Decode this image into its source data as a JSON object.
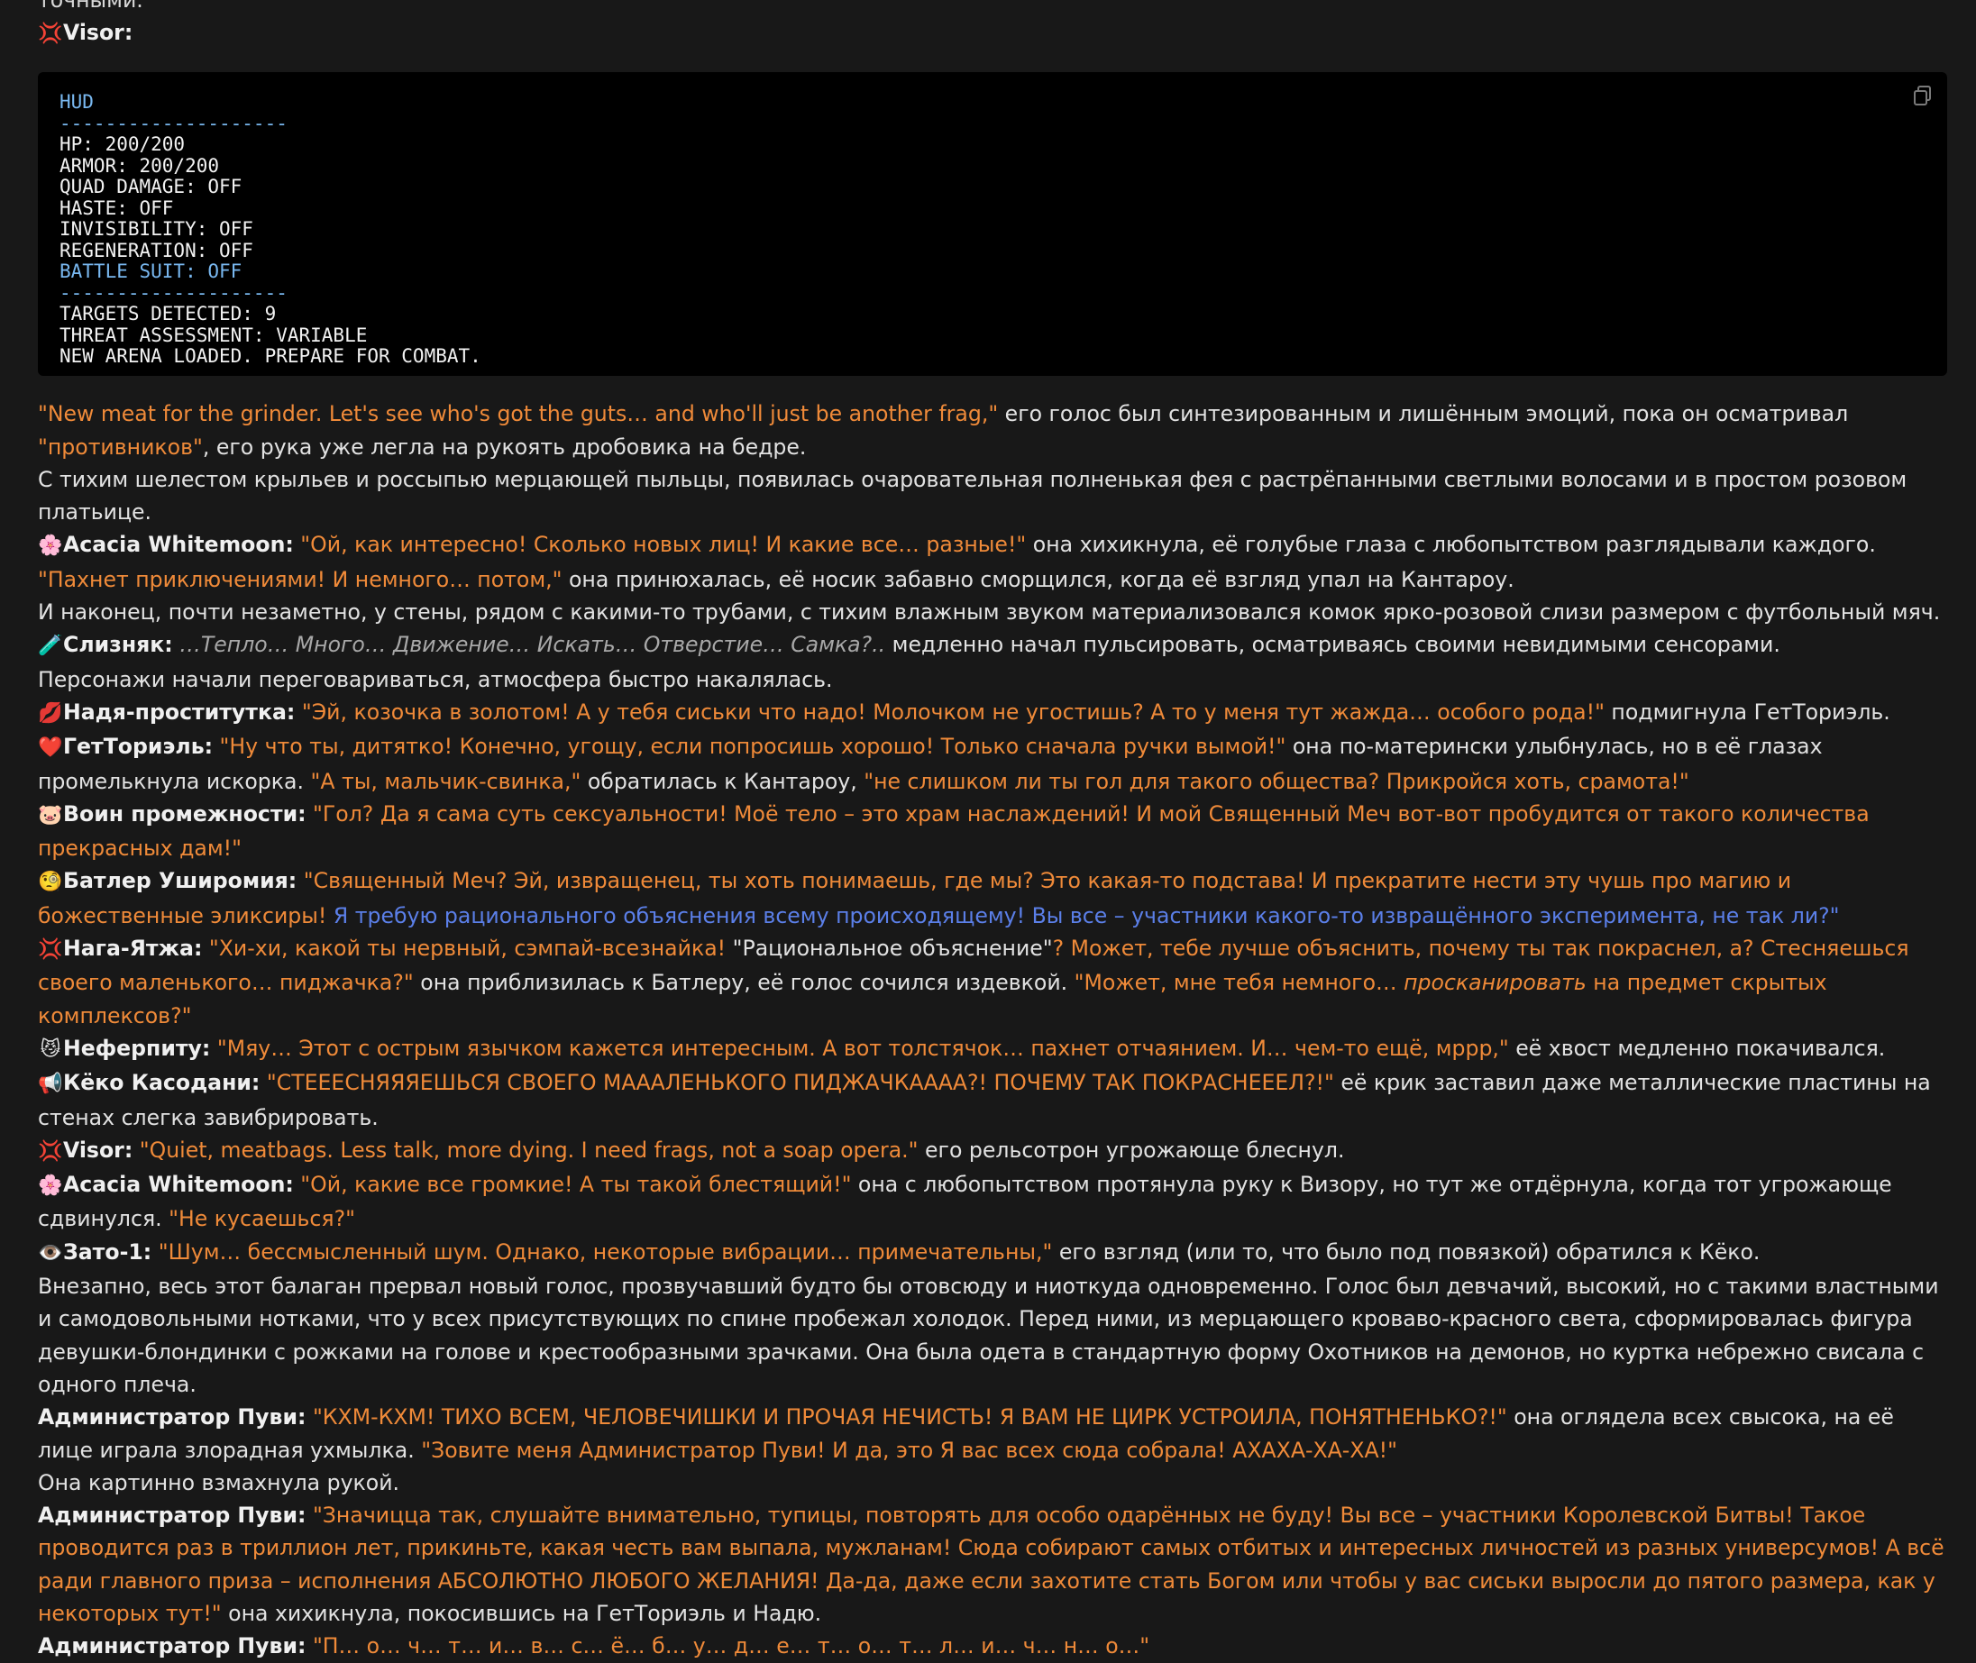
{
  "intro_cut": "точными.",
  "visor_header": {
    "emoji": "💢",
    "name": "Visor:"
  },
  "hud": {
    "copy_icon": "copy-icon",
    "lines": [
      {
        "text": "HUD",
        "hl": true
      },
      {
        "text": "--------------------",
        "hl": true
      },
      {
        "text": "HP: 200/200",
        "hl": false
      },
      {
        "text": "ARMOR: 200/200",
        "hl": false
      },
      {
        "text": "QUAD DAMAGE: OFF",
        "hl": false
      },
      {
        "text": "HASTE: OFF",
        "hl": false
      },
      {
        "text": "INVISIBILITY: OFF",
        "hl": false
      },
      {
        "text": "REGENERATION: OFF",
        "hl": false
      },
      {
        "text": "BATTLE SUIT: OFF",
        "hl": true
      },
      {
        "text": "--------------------",
        "hl": true
      },
      {
        "text": "TARGETS DETECTED: 9",
        "hl": false
      },
      {
        "text": "THREAT ASSESSMENT: VARIABLE",
        "hl": false
      },
      {
        "text": "NEW ARENA LOADED. PREPARE FOR COMBAT.",
        "hl": false
      }
    ]
  },
  "p1": {
    "q1": "\"New meat for the grinder. Let's see who's got the guts… and who'll just be another frag,\"",
    "t1": " его голос был синтезированным и лишённым эмоций, пока он осматривал ",
    "q2": "\"противников\"",
    "t2": ", его рука уже легла на рукоять дробовика на бедре."
  },
  "p2": "С тихим шелестом крыльев и россыпью мерцающей пыльцы, появилась очаровательная полненькая фея с растрёпанными светлыми волосами и в простом розовом платьице.",
  "p3": {
    "emoji": "🌸",
    "name": "Acacia Whitemoon:",
    "q1": " \"Ой, как интересно! Сколько новых лиц! И какие все… разные!\"",
    "t1": " она хихикнула, её голубые глаза с любопытством разглядывали каждого. ",
    "q2": "\"Пахнет приключениями! И немного… потом,\"",
    "t2": " она принюхалась, её носик забавно сморщился, когда её взгляд упал на Кантароу."
  },
  "p4": "И наконец, почти незаметно, у стены, рядом с какими-то трубами, с тихим влажным звуком материализовался комок ярко-розовой слизи размером с футбольный мяч.",
  "p5": {
    "emoji": "🧪",
    "name": "Слизняк:",
    "i1": " …Тепло… Много… Движение… Искать… Отверстие… Самка?..",
    "t1": " медленно начал пульсировать, осматриваясь своими невидимыми сенсорами."
  },
  "p6": "Персонажи начали переговариваться, атмосфера быстро накалялась.",
  "p7": {
    "emoji": "💋",
    "name": "Надя-проститутка:",
    "q1": " \"Эй, козочка в золотом! А у тебя сиськи что надо! Молочком не угостишь? А то у меня тут жажда… особого рода!\"",
    "t1": " подмигнула ГетТориэль."
  },
  "p8": {
    "emoji": "❤️",
    "name": "ГетТориэль:",
    "q1": " \"Ну что ты, дитятко! Конечно, угощу, если попросишь хорошо! Только сначала ручки вымой!\"",
    "t1": " она по-матерински улыбнулась, но в её глазах промелькнула искорка. ",
    "q2": "\"А ты, мальчик-свинка,\"",
    "t2": " обратилась к Кантароу, ",
    "q3": "\"не слишком ли ты гол для такого общества? Прикройся хоть, срамота!\""
  },
  "p9": {
    "emoji": "🐷",
    "name": "Воин промежности:",
    "q1": " \"Гол? Да я сама суть сексуальности! Моё тело – это храм наслаждений! И мой Священный Меч вот-вот пробудится от такого количества прекрасных дам!\""
  },
  "p10": {
    "emoji": "🧐",
    "name": "Батлер Уширомия:",
    "q1": " \"Священный Меч? Эй, извращенец, ты хоть понимаешь, где мы? Это какая-то подстава! И прекратите нести эту чушь про магию и божественные эликсиры!",
    "b1": " Я требую рационального объяснения всему происходящему! Вы все – участники какого-то извращённого эксперимента, не так ли?\""
  },
  "p11": {
    "emoji": "💢",
    "name": "Нага-Ятжа:",
    "q1": " \"Хи-хи, какой ты нервный, сэмпай-всезнайка! ",
    "t1": "\"Рациональное объяснение\"",
    "q2": "? Может, тебе лучше объяснить, почему ты так покраснел, а? Стесняешься своего маленького… пиджачка?\"",
    "t2": " она приблизилась к Батлеру, её голос сочился издевкой. ",
    "q3": "\"Может, мне тебя немного… ",
    "qi": "просканировать",
    "q4": " на предмет скрытых комплексов?\""
  },
  "p12": {
    "emoji": "😼",
    "name": "Неферпиту:",
    "q1": " \"Мяу… Этот с острым язычком кажется интересным. А вот толстячок… пахнет отчаянием. И… чем-то ещё, мррр,\"",
    "t1": " её хвост медленно покачивался."
  },
  "p13": {
    "emoji": "📢",
    "name": "Кёко Касодани:",
    "q1": " \"СТЕЕЕСНЯЯЯЕШЬСЯ СВОЕГО МААAЛЕНЬКОГО ПИДЖАЧКАААА?! ПОЧЕМУ ТАК ПОКРАСНЕЕЕЛ?!\"",
    "t1": " её крик заставил даже металлические пластины на стенах слегка завибрировать."
  },
  "p14": {
    "emoji": "💢",
    "name": "Visor:",
    "q1": " \"Quiet, meatbags. Less talk, more dying. I need frags, not a soap opera.\"",
    "t1": " его рельсотрон угрожающе блеснул."
  },
  "p15": {
    "emoji": "🌸",
    "name": "Acacia Whitemoon:",
    "q1": " \"Ой, какие все громкие! А ты такой блестящий!\"",
    "t1": " она с любопытством протянула руку к Визору, но тут же отдёрнула, когда тот угрожающе сдвинулся. ",
    "q2": "\"Не кусаешься?\""
  },
  "p16": {
    "emoji": "👁️",
    "name": "Зато-1:",
    "q1": " \"Шум… бессмысленный шум. Однако, некоторые вибрации… примечательны,\"",
    "t1": " его взгляд (или то, что было под повязкой) обратился к Кёко."
  },
  "p17": "Внезапно, весь этот балаган прервал новый голос, прозвучавший будто бы отовсюду и ниоткуда одновременно. Голос был девчачий, высокий, но с такими властными и самодовольными нотками, что у всех присутствующих по спине пробежал холодок. Перед ними, из мерцающего кроваво-красного света, сформировалась фигура девушки-блондинки с рожками на голове и крестообразными зрачками. Она была одета в стандартную форму Охотников на демонов, но куртка небрежно свисала с одного плеча.",
  "p18": {
    "name": "Администратор Пуви:",
    "q1": " \"КХМ-КХМ! ТИХО ВСЕМ, ЧЕЛОВЕЧИШКИ И ПРОЧАЯ НЕЧИСТЬ! Я ВАМ НЕ ЦИРК УСТРОИЛА, ПОНЯТНЕНЬКО?!\"",
    "t1": " она оглядела всех свысока, на её лице играла злорадная ухмылка. ",
    "q2": "\"Зовите меня Администратор Пуви! И да, это Я вас всех сюда собрала! АХАХА-ХА-ХА!\""
  },
  "p19": "Она картинно взмахнула рукой.",
  "p20": {
    "name": "Администратор Пуви:",
    "q1": " \"Значицца так, слушайте внимательно, тупицы, повторять для особо одарённых не буду! Вы все – участники Королевской Битвы! Такое проводится раз в триллион лет, прикиньте, какая честь вам выпала, мужланам! Сюда собирают самых отбитых и интересных личностей из разных универсумов! А всё ради главного приза – исполнения АБСОЛЮТНО ЛЮБОГО ЖЕЛАНИЯ! Да-да, даже если захотите стать Богом или чтобы у вас сиськи выросли до пятого размера, как у некоторых тут!\"",
    "t1": " она хихикнула, покосившись на ГетТориэль и Надю."
  },
  "p21_cut": {
    "name": "Администратор Пуви:",
    "q1": " \"П… о… ч… т… и… в… с… ё… б… у… д… е… т… о… т… л… и… ч… н… о…\""
  }
}
